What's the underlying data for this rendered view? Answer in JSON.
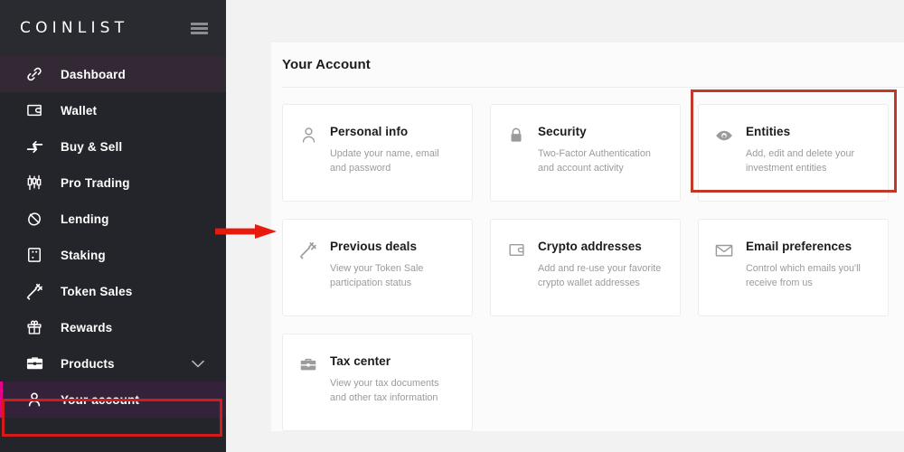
{
  "brand": {
    "name": "COINLIST",
    "menu_icon": "hamburger-menu-icon"
  },
  "sidebar": {
    "items": [
      {
        "label": "Dashboard",
        "icon": "link-chain-icon",
        "state": "hover"
      },
      {
        "label": "Wallet",
        "icon": "wallet-icon",
        "state": "normal"
      },
      {
        "label": "Buy & Sell",
        "icon": "exchange-arrows-icon",
        "state": "normal"
      },
      {
        "label": "Pro Trading",
        "icon": "candlestick-chart-icon",
        "state": "normal"
      },
      {
        "label": "Lending",
        "icon": "acorn-icon",
        "state": "normal"
      },
      {
        "label": "Staking",
        "icon": "dice-icon",
        "state": "normal"
      },
      {
        "label": "Token Sales",
        "icon": "gavel-icon",
        "state": "normal"
      },
      {
        "label": "Rewards",
        "icon": "gift-icon",
        "state": "normal"
      },
      {
        "label": "Products",
        "icon": "briefcase-icon",
        "state": "normal",
        "chevron": "chevron-down-icon"
      },
      {
        "label": "Your account",
        "icon": "person-icon",
        "state": "active"
      }
    ]
  },
  "main": {
    "page_title": "Your Account",
    "cards": [
      {
        "title": "Personal info",
        "desc": "Update your name, email and password",
        "icon": "person-outline-icon",
        "highlighted": false
      },
      {
        "title": "Security",
        "desc": "Two-Factor Authentication and account activity",
        "icon": "lock-icon",
        "highlighted": false
      },
      {
        "title": "Entities",
        "desc": "Add, edit and delete your investment entities",
        "icon": "eye-icon",
        "highlighted": true
      },
      {
        "title": "Previous deals",
        "desc": "View your Token Sale participation status",
        "icon": "gavel-icon",
        "highlighted": false
      },
      {
        "title": "Crypto addresses",
        "desc": "Add and re-use your favorite crypto wallet addresses",
        "icon": "wallet-outline-icon",
        "highlighted": false
      },
      {
        "title": "Email preferences",
        "desc": "Control which emails you'll receive from us",
        "icon": "envelope-icon",
        "highlighted": false
      },
      {
        "title": "Tax center",
        "desc": "View your tax documents and other tax information",
        "icon": "briefcase-icon",
        "highlighted": false
      }
    ]
  },
  "annotations": {
    "sidebar_box_color": "#d51a1a",
    "card_box_color": "#c0392b",
    "arrow_color": "#e81a0c",
    "arrow_name": "red-pointer-arrow"
  },
  "colors": {
    "sidebar_bg": "#24242b",
    "sidebar_header_bg": "#2a2a31",
    "accent_magenta": "#e6008a",
    "active_row_bg": "#33223a",
    "page_bg": "#f2f2f2",
    "card_bg": "#ffffff",
    "text_primary": "#1c1c1c",
    "text_muted": "#9b9b9b"
  }
}
